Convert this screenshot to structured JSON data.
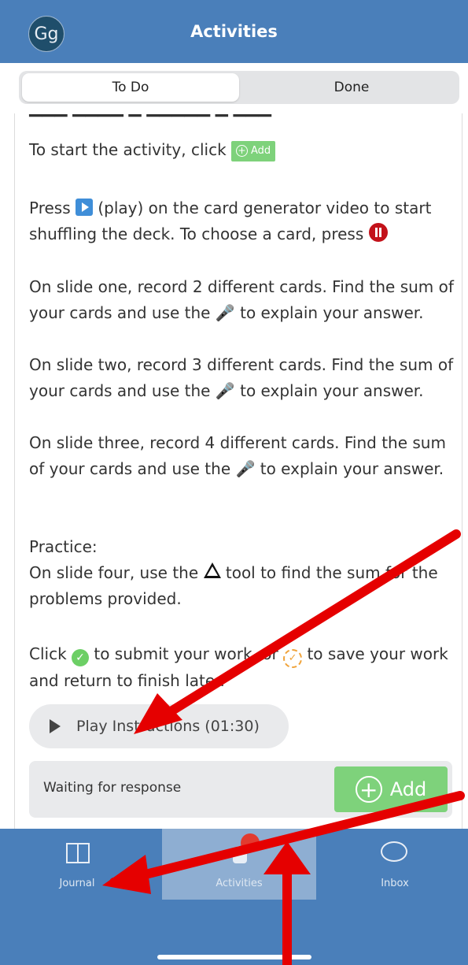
{
  "header": {
    "avatar": "Gg",
    "title": "Activities"
  },
  "tabs": {
    "todo": "To Do",
    "done": "Done"
  },
  "content": {
    "start_pre": "To start the activity, click",
    "inline_add": "Add",
    "press_1": "Press",
    "press_2": "(play) on the card generator video to start shuffling the deck.  To choose a card, press",
    "slide1_a": "On slide one, record 2 different cards.  Find the sum of your cards and use the",
    "slide1_b": "to explain your answer.",
    "slide2_a": "On slide two, record 3 different cards.  Find the sum of your cards and use the",
    "slide2_b": "to explain your answer.",
    "slide3_a": "On slide three, record 4 different cards.  Find the sum of your cards and use the",
    "slide3_b": "to explain your answer.",
    "practice_title": "Practice:",
    "practice_a": "On slide four, use the",
    "practice_b": "tool to find the sum for the problems provided.",
    "submit_a": "Click",
    "submit_b": "to submit your work, or",
    "submit_c": "to save your work and return to finish later."
  },
  "play_instructions": "Play Instructions (01:30)",
  "response": {
    "label": "Waiting for response",
    "add": "Add"
  },
  "more": "•••",
  "nav": {
    "journal": "Journal",
    "activities": "Activities",
    "inbox": "Inbox"
  }
}
